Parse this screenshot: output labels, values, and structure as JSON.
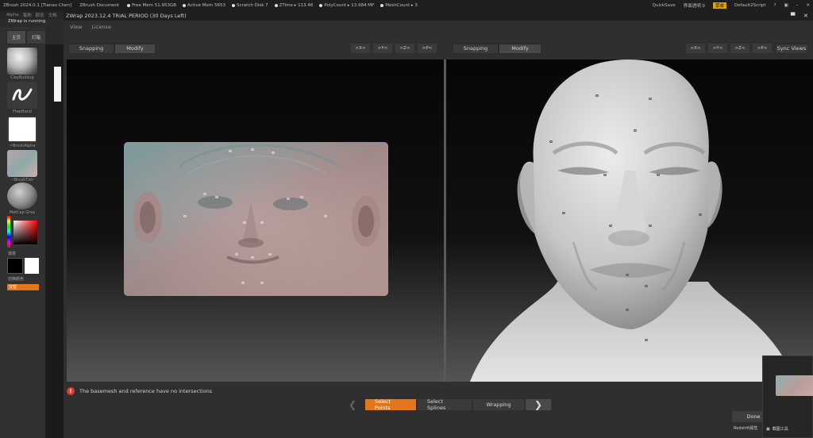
{
  "zbrush": {
    "title_items": [
      "ZBrush 2024.0.1 [Tianao Chen]",
      "ZBrush Document"
    ],
    "status": [
      "Free Mem 51.953GB",
      "Active Mem 5653",
      "Scratch Disk 7",
      "ZTime ▸ 113.46",
      "PolyCount ▸ 13.984 MP",
      "MeshCount ▸ 3"
    ],
    "right": [
      "QuickSave",
      "界面透明 0",
      "菜单",
      "Default2Script"
    ],
    "menu": [
      "Alpha",
      "笔刷",
      "颜色",
      "文档"
    ],
    "running": "ZWrap is running",
    "tabs": [
      "主页",
      "灯箱"
    ],
    "tools": [
      {
        "label": "ClayBuildup"
      },
      {
        "label": "FreeHand"
      },
      {
        "label": "~BrushAlpha"
      },
      {
        "label": "~BrushTxtr"
      },
      {
        "label": "MatCap Gray"
      }
    ],
    "gradient_label": "渐变",
    "switch_color_label": "切换颜色",
    "alternate_label": "交替"
  },
  "zwrap": {
    "title": "ZWrap 2023.12.4  TRIAL PERIOD (30 Days Left)",
    "menu": [
      "View",
      "License"
    ],
    "left_toolbar": {
      "snapping": "Snapping",
      "modify": "Modify",
      "axes": [
        ">X<",
        ">Y<",
        ">Z<",
        ">P<"
      ]
    },
    "right_toolbar": {
      "snapping": "Snapping",
      "modify": "Modify",
      "axes": [
        ">X<",
        ">Y<",
        ">Z<",
        ">P<"
      ],
      "sync": "Sync Views"
    },
    "warning": "The basemesh and reference have no intersections",
    "steps": [
      "Select Points",
      "Select Splines",
      "Wrapping"
    ],
    "active_step": "Select Points",
    "done": "Done"
  },
  "thumb_panel": {
    "label": "截图工具"
  },
  "redshift_label": "Redshift属性",
  "colors": {
    "accent": "#e2761b",
    "warning": "#e53935"
  }
}
